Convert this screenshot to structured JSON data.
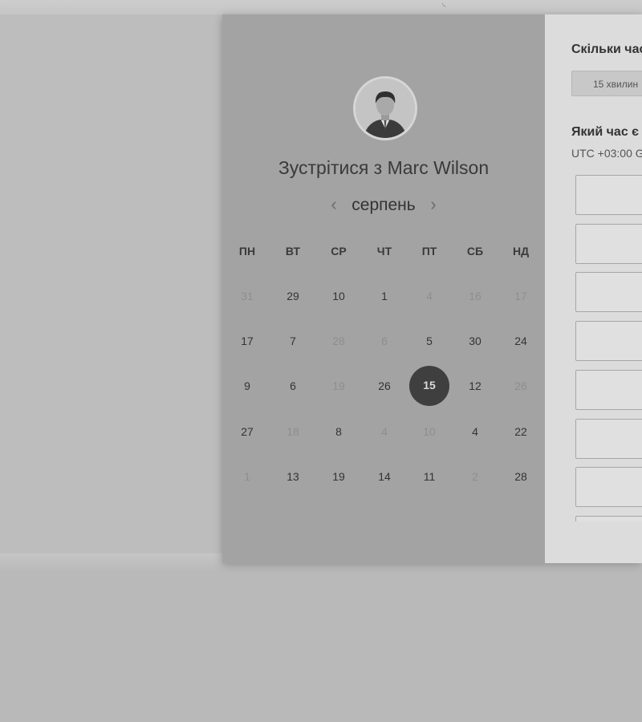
{
  "background": {
    "top_glyph": "◟"
  },
  "meeting": {
    "title": "Зустрітися з Marc Wilson",
    "avatar_alt": "Marc Wilson"
  },
  "calendar": {
    "month": "серпень",
    "prev_icon": "‹",
    "next_icon": "›",
    "weekdays": [
      "ПН",
      "ВТ",
      "СР",
      "ЧТ",
      "ПТ",
      "СБ",
      "НД"
    ],
    "weeks": [
      [
        {
          "d": "31",
          "dim": true
        },
        {
          "d": "29"
        },
        {
          "d": "10"
        },
        {
          "d": "1"
        },
        {
          "d": "4",
          "dim": true
        },
        {
          "d": "16",
          "dim": true
        },
        {
          "d": "17",
          "dim": true
        }
      ],
      [
        {
          "d": "17"
        },
        {
          "d": "7"
        },
        {
          "d": "28",
          "dim": true
        },
        {
          "d": "6",
          "dim": true
        },
        {
          "d": "5"
        },
        {
          "d": "30"
        },
        {
          "d": "24"
        }
      ],
      [
        {
          "d": "9"
        },
        {
          "d": "6"
        },
        {
          "d": "19",
          "dim": true
        },
        {
          "d": "26"
        },
        {
          "d": "15",
          "selected": true
        },
        {
          "d": "12"
        },
        {
          "d": "26",
          "dim": true
        }
      ],
      [
        {
          "d": "27"
        },
        {
          "d": "18",
          "dim": true
        },
        {
          "d": "8"
        },
        {
          "d": "4",
          "dim": true
        },
        {
          "d": "10",
          "dim": true
        },
        {
          "d": "4"
        },
        {
          "d": "22"
        }
      ],
      [
        {
          "d": "1",
          "dim": true
        },
        {
          "d": "13"
        },
        {
          "d": "19"
        },
        {
          "d": "14"
        },
        {
          "d": "11"
        },
        {
          "d": "2",
          "dim": true
        },
        {
          "d": "28"
        }
      ]
    ]
  },
  "booking": {
    "duration_heading": "Скільки час",
    "duration_option": "15 хвилин",
    "time_heading": "Який час є",
    "timezone": "UTC +03:00 G",
    "slot_count": 8
  }
}
